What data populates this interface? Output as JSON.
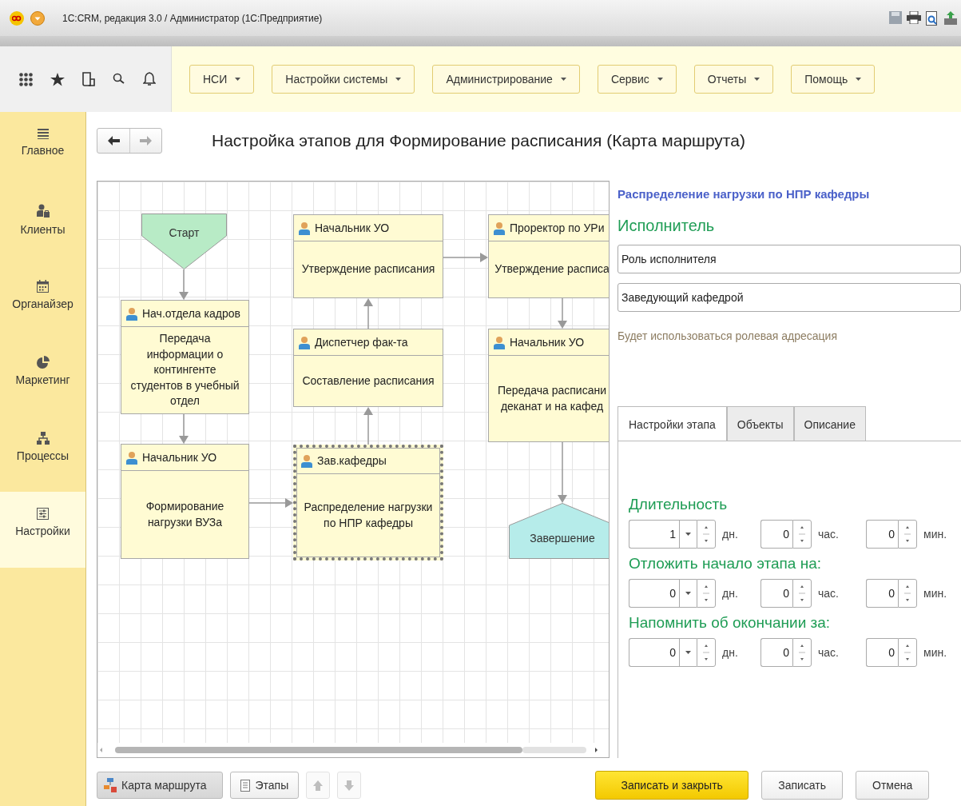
{
  "window": {
    "title": "1С:CRM, редакция 3.0 / Администратор  (1С:Предприятие)"
  },
  "menu": [
    {
      "label": "НСИ"
    },
    {
      "label": "Настройки системы"
    },
    {
      "label": "Администрирование"
    },
    {
      "label": "Сервис"
    },
    {
      "label": "Отчеты"
    },
    {
      "label": "Помощь"
    }
  ],
  "sidebar": {
    "items": [
      {
        "label": "Главное",
        "kind": "list",
        "selected": false
      },
      {
        "label": "Клиенты",
        "kind": "clients",
        "selected": false
      },
      {
        "label": "Органайзер",
        "kind": "calendar",
        "selected": false
      },
      {
        "label": "Маркетинг",
        "kind": "pie",
        "selected": false
      },
      {
        "label": "Процессы",
        "kind": "hierarchy",
        "selected": false
      },
      {
        "label": "Настройки",
        "kind": "settings",
        "selected": true
      }
    ]
  },
  "page_title": "Настройка этапов для Формирование расписания (Карта маршрута)",
  "diagram": {
    "nodes": [
      {
        "kind": "start",
        "label": "Старт"
      },
      {
        "kind": "task",
        "role": "Начальник УО",
        "text": "Утверждение расписания",
        "selected": false
      },
      {
        "kind": "task",
        "role": "Проректор по УРи",
        "text": "Утверждение расписа",
        "selected": false
      },
      {
        "kind": "task",
        "role": "Нач.отдела кадров",
        "text": "Передача информации о контингенте студентов в учебный отдел",
        "selected": false
      },
      {
        "kind": "task",
        "role": "Диспетчер фак-та",
        "text": "Составление расписания",
        "selected": false
      },
      {
        "kind": "task",
        "role": "Начальник УО",
        "text": "Передача расписани деканат и на кафед",
        "selected": false
      },
      {
        "kind": "task",
        "role": "Начальник УО",
        "text": "Формирование нагрузки ВУЗа",
        "selected": false
      },
      {
        "kind": "task",
        "role": "Зав.кафедры",
        "text": "Распределение нагрузки по НПР кафедры",
        "selected": true
      },
      {
        "kind": "end",
        "label": "Завершение"
      }
    ]
  },
  "stage": {
    "heading": "Распределение нагрузки по НПР кафедры",
    "executor_label": "Исполнитель",
    "executor_type": "Роль исполнителя",
    "executor": "Заведующий кафедрой",
    "hint": "Будет использоваться ролевая адресация"
  },
  "tabs": [
    {
      "label": "Настройки этапа",
      "selected": true
    },
    {
      "label": "Объекты",
      "selected": false
    },
    {
      "label": "Описание",
      "selected": false
    }
  ],
  "timing": [
    {
      "label": "Длительность",
      "fields": [
        {
          "kind": "days",
          "value": "1",
          "unit": "дн."
        },
        {
          "kind": "spin",
          "value": "0",
          "unit": "час."
        },
        {
          "kind": "spin",
          "value": "0",
          "unit": "мин."
        }
      ]
    },
    {
      "label": "Отложить начало этапа на:",
      "fields": [
        {
          "kind": "days",
          "value": "0",
          "unit": "дн."
        },
        {
          "kind": "spin",
          "value": "0",
          "unit": "час."
        },
        {
          "kind": "spin",
          "value": "0",
          "unit": "мин."
        }
      ]
    },
    {
      "label": "Напомнить об окончании за:",
      "fields": [
        {
          "kind": "days",
          "value": "0",
          "unit": "дн."
        },
        {
          "kind": "spin",
          "value": "0",
          "unit": "час."
        },
        {
          "kind": "spin",
          "value": "0",
          "unit": "мин."
        }
      ]
    }
  ],
  "bottom_buttons": [
    {
      "kind": "map",
      "label": "Карта маршрута",
      "selected": true
    },
    {
      "kind": "list",
      "label": "Этапы",
      "selected": false
    },
    {
      "kind": "up",
      "disabled": true
    },
    {
      "kind": "down",
      "disabled": true
    }
  ],
  "actions": [
    {
      "label": "Записать и закрыть",
      "kind": "primary"
    },
    {
      "label": "Записать",
      "kind": "plain"
    },
    {
      "label": "Отмена",
      "kind": "plain"
    }
  ]
}
